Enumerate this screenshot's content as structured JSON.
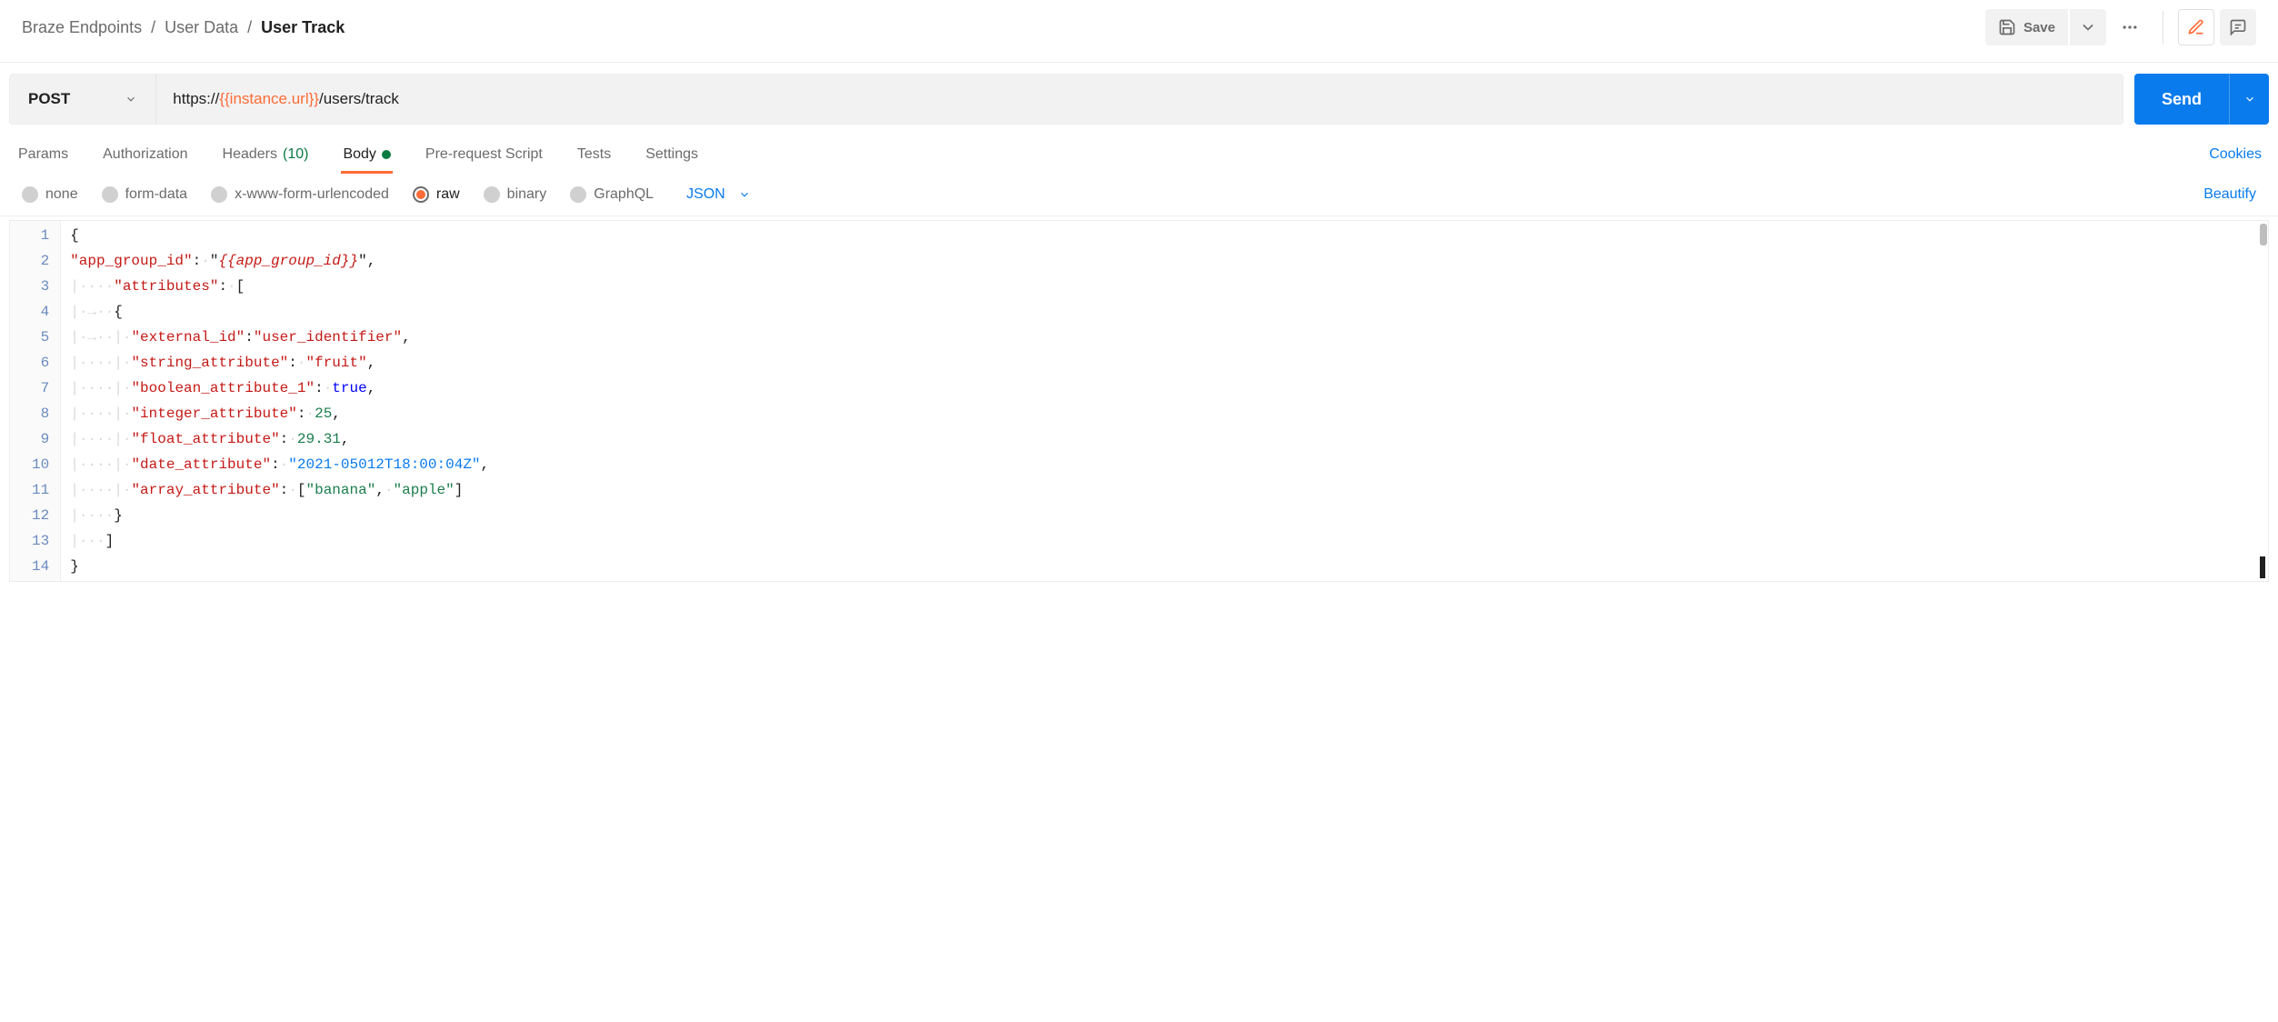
{
  "breadcrumb": {
    "root": "Braze Endpoints",
    "group": "User Data",
    "current": "User Track"
  },
  "toolbar": {
    "save_label": "Save",
    "send_label": "Send"
  },
  "request": {
    "method": "POST",
    "url_prefix": "https://",
    "url_var": "{{instance.url}}",
    "url_suffix": "/users/track"
  },
  "tabs": {
    "params": "Params",
    "authorization": "Authorization",
    "headers": "Headers",
    "headers_count": "(10)",
    "body": "Body",
    "prerequest": "Pre-request Script",
    "tests": "Tests",
    "settings": "Settings",
    "cookies": "Cookies"
  },
  "body_types": {
    "none": "none",
    "formdata": "form-data",
    "urlencoded": "x-www-form-urlencoded",
    "raw": "raw",
    "binary": "binary",
    "graphql": "GraphQL",
    "language": "JSON",
    "beautify": "Beautify"
  },
  "editor": {
    "line_numbers": [
      "1",
      "2",
      "3",
      "4",
      "5",
      "6",
      "7",
      "8",
      "9",
      "10",
      "11",
      "12",
      "13",
      "14"
    ],
    "tokens": {
      "l2_key": "\"app_group_id\"",
      "l2_val": "{{app_group_id}}",
      "l3_key": "\"attributes\"",
      "l5_key": "\"external_id\"",
      "l5_val": "\"user_identifier\"",
      "l6_key": "\"string_attribute\"",
      "l6_val": "\"fruit\"",
      "l7_key": "\"boolean_attribute_1\"",
      "l7_val": "true",
      "l8_key": "\"integer_attribute\"",
      "l8_val": "25",
      "l9_key": "\"float_attribute\"",
      "l9_val": "29.31",
      "l10_key": "\"date_attribute\"",
      "l10_val": "\"2021-05012T18:00:04Z\"",
      "l11_key": "\"array_attribute\"",
      "l11_v1": "\"banana\"",
      "l11_v2": "\"apple\""
    }
  }
}
